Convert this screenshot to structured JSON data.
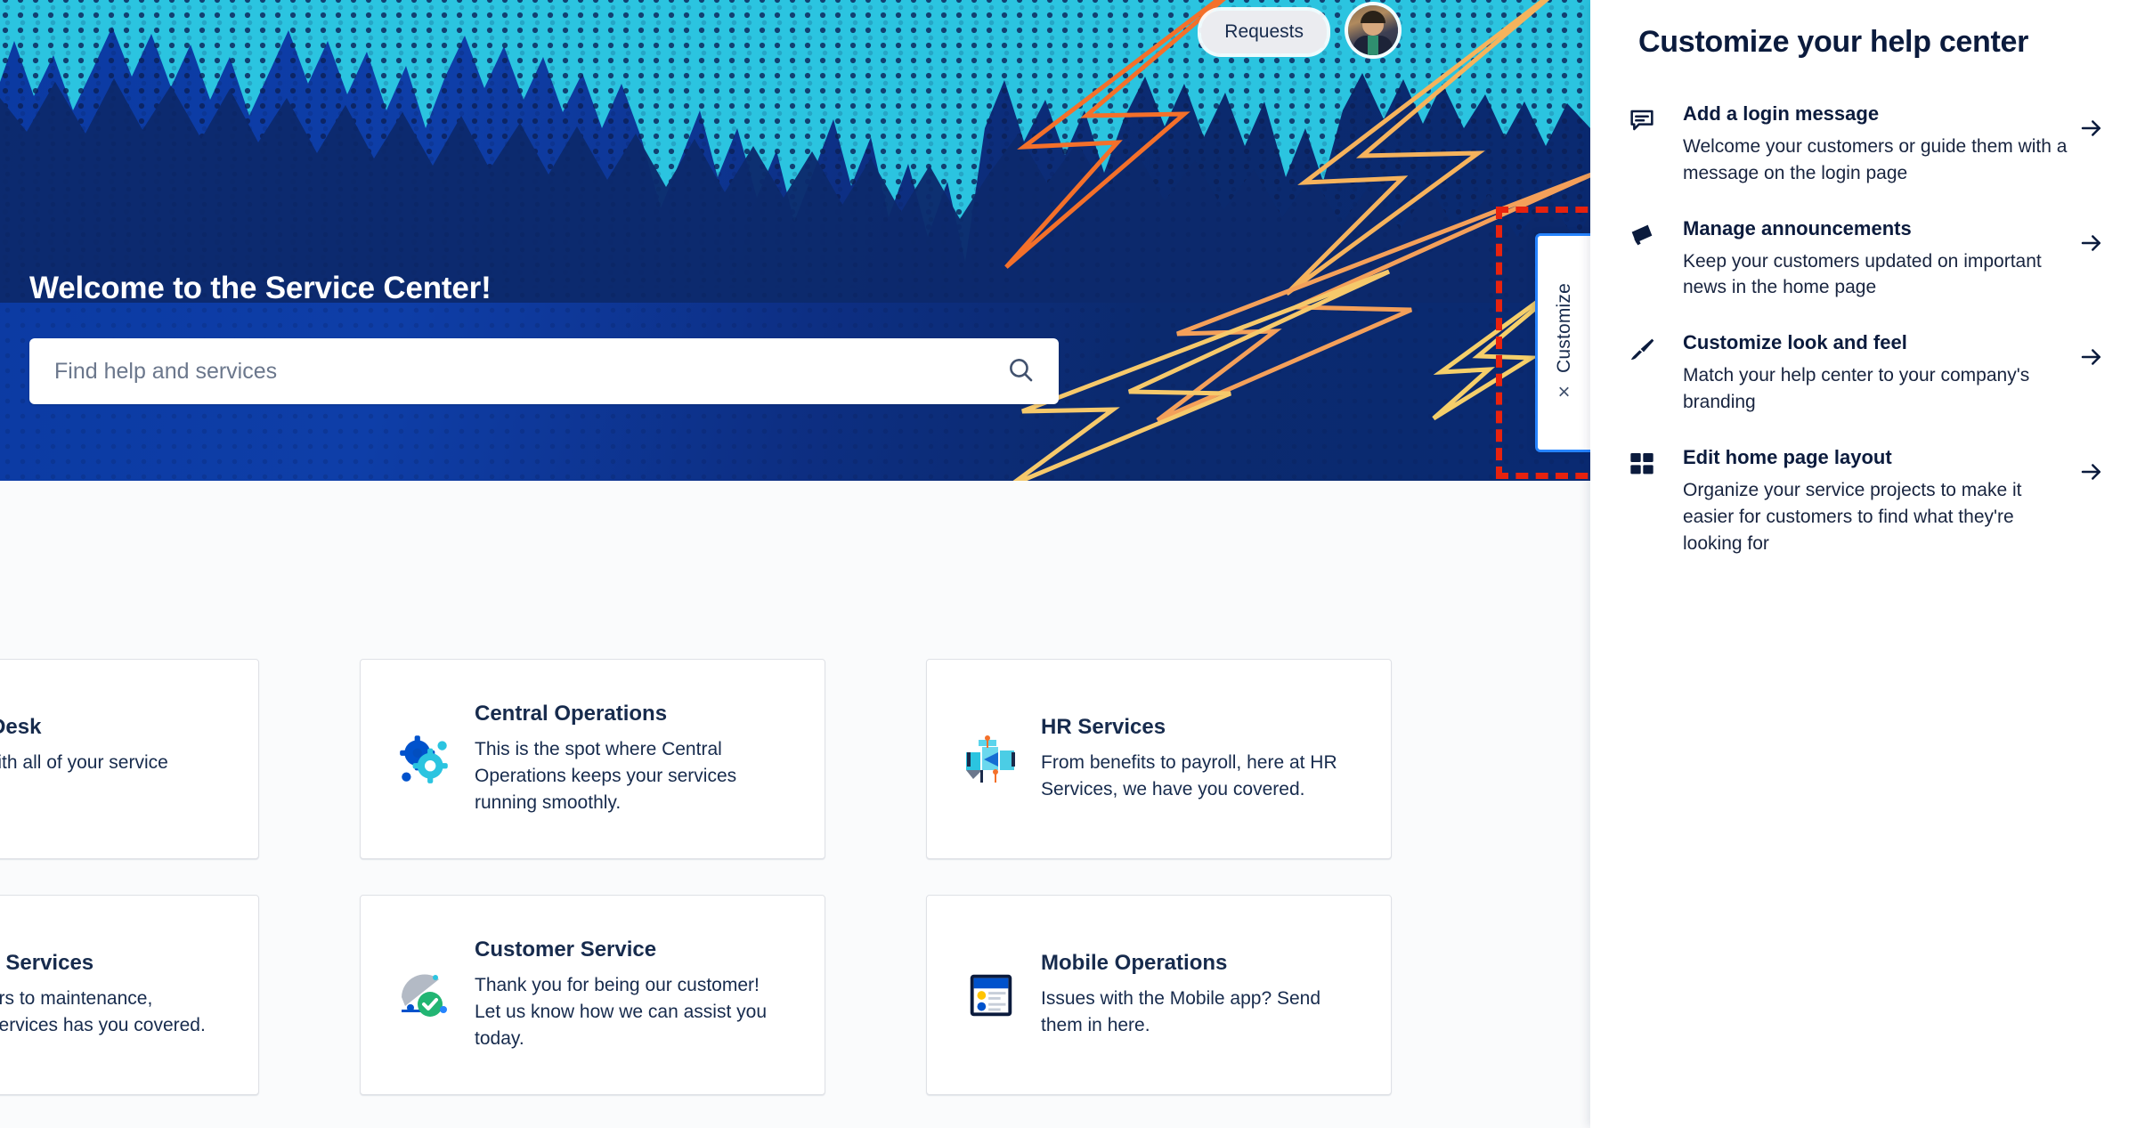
{
  "hero": {
    "welcome_title": "Welcome to the Service Center!",
    "search_placeholder": "Find help and services",
    "search_value": "",
    "requests_label": "Requests",
    "search_icon": "search-icon",
    "avatar_name": "user-avatar"
  },
  "customize_tab": {
    "label": "Customize",
    "close_label": "×"
  },
  "cards": [
    {
      "title": "Service Desk",
      "desc": "Get help with all of your service needs.",
      "icon": "headset-icon",
      "clipped": true
    },
    {
      "title": "Central Operations",
      "desc": "This is the spot where Central Operations keeps your services running smoothly.",
      "icon": "gears-icon",
      "clipped": false
    },
    {
      "title": "HR Services",
      "desc": "From benefits to payroll, here at HR Services, we have you covered.",
      "icon": "people-icon",
      "clipped": false
    },
    {
      "title": "Facilities Services",
      "desc": "From repairs to maintenance, Facilities Services has you covered.",
      "icon": "umbrella-icon",
      "clipped": true
    },
    {
      "title": "Customer Service",
      "desc": "Thank you for being our customer! Let us know how we can assist you today.",
      "icon": "check-shield-icon",
      "clipped": false
    },
    {
      "title": "Mobile Operations",
      "desc": "Issues with the Mobile app? Send them in here.",
      "icon": "mobile-icon",
      "clipped": false
    }
  ],
  "panel": {
    "title": "Customize your help center",
    "items": [
      {
        "title": "Add a login message",
        "desc": "Welcome your customers or guide them with a message on the login page",
        "icon": "comment-icon",
        "arrow": "→"
      },
      {
        "title": "Manage announcements",
        "desc": "Keep your customers updated on important news in the home page",
        "icon": "megaphone-icon",
        "arrow": "→"
      },
      {
        "title": "Customize look and feel",
        "desc": "Match your help center to your company's branding",
        "icon": "paintbrush-icon",
        "arrow": "→"
      },
      {
        "title": "Edit home page layout",
        "desc": "Organize your service projects to make it easier for customers to find what they're looking for",
        "icon": "grid-icon",
        "arrow": "→"
      }
    ]
  },
  "colors": {
    "hero_blue_dark": "#0a2a6e",
    "hero_blue": "#0b3aa2",
    "hero_cyan": "#2bc4e0",
    "bolt_orange": "#f4702a",
    "bolt_yellow": "#f5cf6a",
    "accent_blue": "#2684ff",
    "highlight_red": "#e8220e",
    "text_navy": "#0b1b3d",
    "text_body": "#172b4d"
  }
}
